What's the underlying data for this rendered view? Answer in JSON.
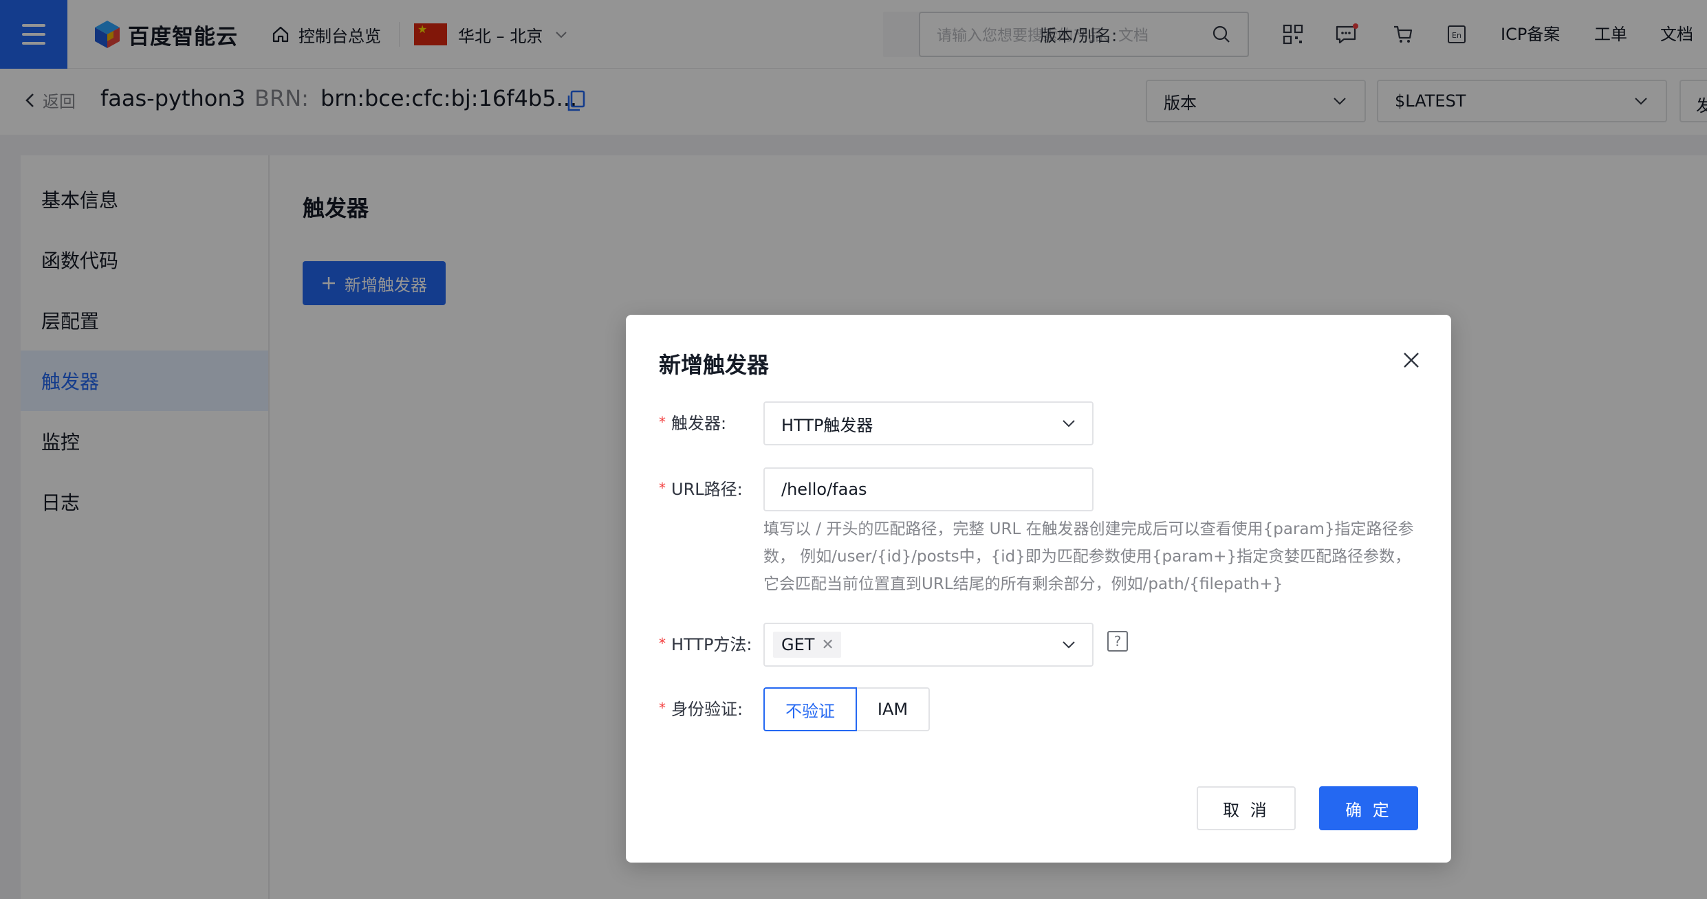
{
  "header": {
    "logo_text": "百度智能云",
    "console_overview": "控制台总览",
    "region": "华北 – 北京",
    "search_placeholder": "请输入您想要搜索的产品、文档",
    "icp": "ICP备案",
    "ticket": "工单",
    "docs": "文档",
    "brand_color": "#2468f2"
  },
  "subheader": {
    "back": "返回",
    "function_name": "faas-python3",
    "brn_label": "BRN:",
    "brn_value": "brn:bce:cfc:bj:16f4b5...",
    "version_alias_label": "版本/别名:",
    "version_select": "版本",
    "latest_select": "$LATEST",
    "publish_partial": "发"
  },
  "sidebar": {
    "items": [
      {
        "label": "基本信息"
      },
      {
        "label": "函数代码"
      },
      {
        "label": "层配置"
      },
      {
        "label": "触发器"
      },
      {
        "label": "监控"
      },
      {
        "label": "日志"
      }
    ],
    "active_index": 3
  },
  "main": {
    "title": "触发器",
    "add_button": "新增触发器"
  },
  "modal": {
    "title": "新增触发器",
    "trigger_label": "触发器:",
    "trigger_value": "HTTP触发器",
    "url_label": "URL路径:",
    "url_value": "/hello/faas",
    "url_hint": "填写以 / 开头的匹配路径，完整 URL 在触发器创建完成后可以查看使用{param}指定路径参数， 例如/user/{id}/posts中，{id}即为匹配参数使用{param+}指定贪婪匹配路径参数，它会匹配当前位置直到URL结尾的所有剩余部分，例如/path/{filepath+}",
    "method_label": "HTTP方法:",
    "method_tag": "GET",
    "auth_label": "身份验证:",
    "auth_options": [
      "不验证",
      "IAM"
    ],
    "auth_selected": "不验证",
    "cancel": "取 消",
    "confirm": "确 定"
  }
}
